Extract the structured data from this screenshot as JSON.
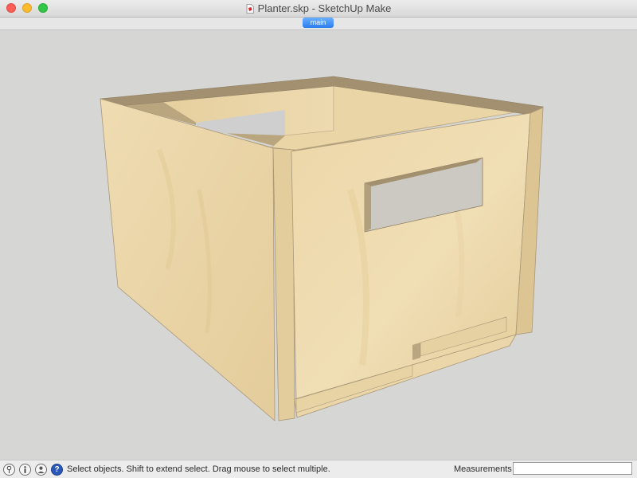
{
  "window": {
    "title": "Planter.skp - SketchUp Make"
  },
  "scene_tabs": {
    "active_label": "main"
  },
  "statusbar": {
    "instruction": "Select objects. Shift to extend select. Drag mouse to select multiple.",
    "measurements_label": "Measurements",
    "measurements_value": ""
  },
  "model": {
    "name": "Planter",
    "material": "plywood",
    "colors": {
      "wood_light": "#efdcb1",
      "wood_mid": "#e7cf9d",
      "wood_shadow": "#c8b48a",
      "edge": "#a8977a",
      "background": "#d6d6d5"
    }
  },
  "icons": {
    "geo_location": "geo-location-icon",
    "credits": "credits-icon",
    "user": "user-icon",
    "help": "help-icon"
  }
}
